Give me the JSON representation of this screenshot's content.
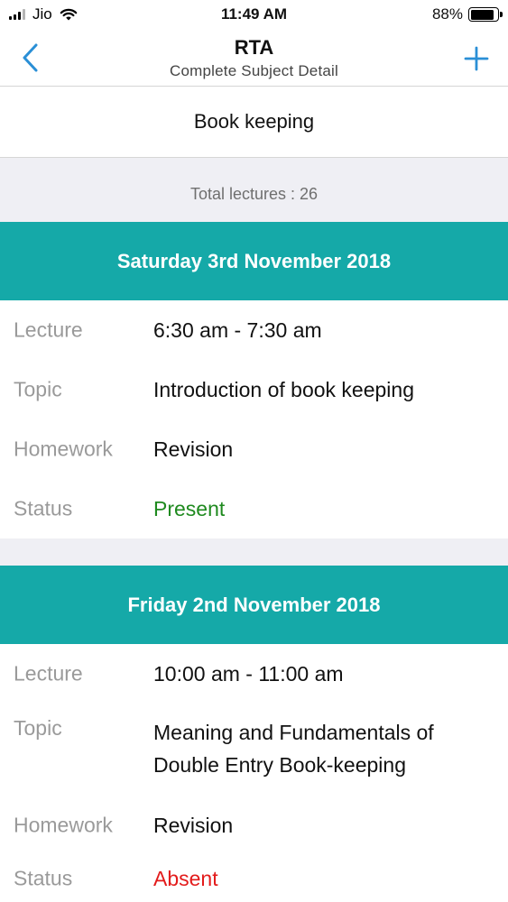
{
  "status_bar": {
    "carrier": "Jio",
    "time": "11:49 AM",
    "battery_percent": "88%",
    "battery_level": 0.88
  },
  "nav": {
    "title": "RTA",
    "subtitle": "Complete Subject Detail",
    "back_icon": "chevron-left-icon",
    "add_icon": "plus-icon",
    "accent_color": "#2a8fd6"
  },
  "subject": {
    "name": "Book keeping",
    "total_lectures": "Total lectures : 26"
  },
  "labels": {
    "lecture": "Lecture",
    "topic": "Topic",
    "homework": "Homework",
    "status": "Status"
  },
  "lectures": [
    {
      "date": "Saturday 3rd November 2018",
      "time": "6:30 am - 7:30 am",
      "topic": "Introduction of book keeping",
      "homework": "Revision",
      "status": "Present",
      "status_color": "#1f8a1f"
    },
    {
      "date": "Friday 2nd November 2018",
      "time": "10:00 am - 11:00 am",
      "topic": "Meaning and Fundamentals of Double Entry Book-keeping",
      "homework": "Revision",
      "status": "Absent",
      "status_color": "#e31b1b"
    }
  ],
  "colors": {
    "date_header": "#15a9a8",
    "section_background": "#efeff4"
  }
}
